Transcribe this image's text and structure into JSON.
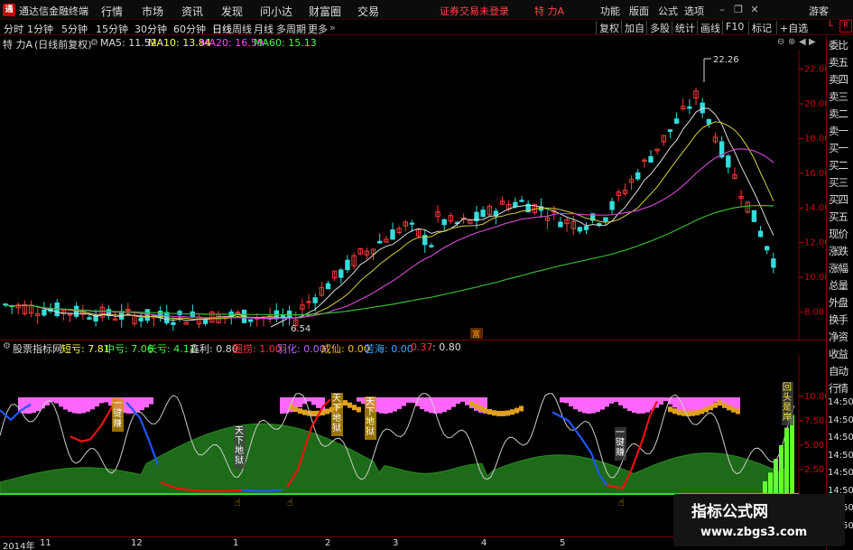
{
  "app": {
    "name": "通达信金融终端"
  },
  "menu": [
    "行情",
    "市场",
    "资讯",
    "发现",
    "问小达",
    "财富圈",
    "交易"
  ],
  "login_notice": "证券交易未登录",
  "stock_title": "特 力A",
  "right_menu": [
    "功能",
    "版面",
    "公式",
    "选项"
  ],
  "guest": "游客",
  "period_tabs": [
    "分时",
    "1分钟",
    "5分钟",
    "15分钟",
    "30分钟",
    "60分钟",
    "日线",
    "周线",
    "月线",
    "多周期",
    "更多"
  ],
  "active_tab": "日线",
  "right_buttons": [
    "复权",
    "加自",
    "多股",
    "统计",
    "画线",
    "F10",
    "标记",
    "+自选"
  ],
  "chart_header": {
    "name": "特 力A",
    "mode": "(日线前复权)",
    "ma5": "MA5: 11.52",
    "ma10": "MA10: 13.84",
    "ma20": "MA20: 16.59",
    "ma60": "MA60: 15.13"
  },
  "annotations": {
    "high": "22.26",
    "low": "6.54",
    "mark": "富"
  },
  "price_axis": [
    "22.00",
    "20.00",
    "18.00",
    "16.00",
    "14.00",
    "12.00",
    "10.00",
    "8.00"
  ],
  "indicator_bar": {
    "name": "股票指标网",
    "items": [
      {
        "label": "短亏: 7.81",
        "color": "#ffff44"
      },
      {
        "label": "中亏: 7.06",
        "color": "#44ff44"
      },
      {
        "label": "长亏: 4.11",
        "color": "#44ff44"
      },
      {
        "label": "鑫利: 0.80",
        "color": "#dddddd"
      },
      {
        "label": "圈捞: 1.00",
        "color": "#ff3333"
      },
      {
        "label": "羽化: 0.00",
        "color": "#bb66ff"
      },
      {
        "label": "成仙: 0.00",
        "color": "#ffbb33"
      },
      {
        "label": "苦海: 0.00",
        "color": "#44aaff"
      },
      {
        "label": "0.37",
        "color": "#ff3333"
      },
      {
        "label": ": 0.80",
        "color": "#dddddd"
      }
    ]
  },
  "sub_axis": [
    "10.00",
    "7.50",
    "5.00",
    "2.50"
  ],
  "sub_labels": [
    "一键赚",
    "天下地狱",
    "天下地狱",
    "天下地狱",
    "一键赚",
    "回头是岸"
  ],
  "time_axis": [
    "2014年",
    "11",
    "12",
    "1",
    "2",
    "3",
    "4",
    "5"
  ],
  "side_panel": [
    "委比",
    "卖五",
    "卖四",
    "卖三",
    "卖二",
    "卖一",
    "买一",
    "买二",
    "买三",
    "买四",
    "买五",
    "现价",
    "涨跌",
    "涨幅",
    "总量",
    "外盘",
    "换手",
    "净资",
    "收益",
    "自动",
    "行情"
  ],
  "side_clock": [
    "14:50",
    "14:50",
    "14:50",
    "14:50",
    "14:50",
    "14:50",
    "14:50",
    "14:50"
  ],
  "watermark": {
    "title": "指标公式网",
    "url": "www.zbgs3.com"
  }
}
